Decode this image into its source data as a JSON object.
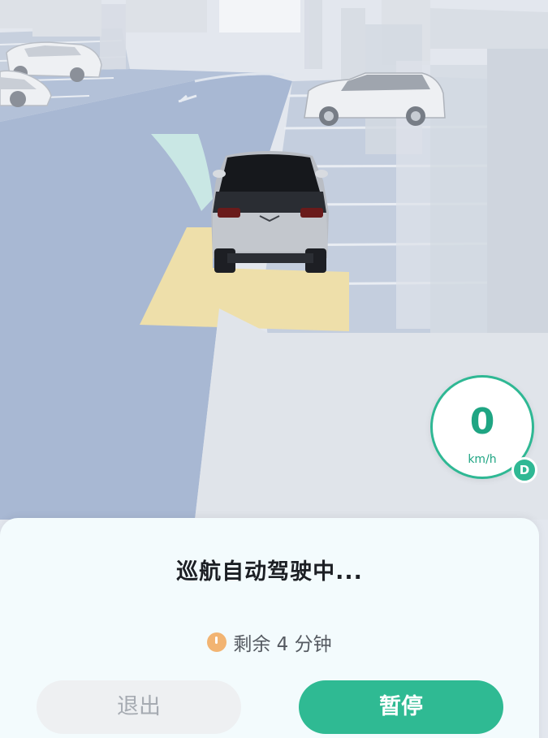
{
  "speedometer": {
    "value": "0",
    "unit": "km/h",
    "gear": "D"
  },
  "panel": {
    "title": "巡航自动驾驶中...",
    "remaining": "剩余 4 分钟",
    "exit_label": "退出",
    "pause_label": "暂停"
  },
  "colors": {
    "accent": "#2fba93",
    "exit_bg": "#eef0f2",
    "panel_bg": "#f3fbfd",
    "trajectory": "#c9e7e4",
    "target_zone": "#eedfaa"
  }
}
